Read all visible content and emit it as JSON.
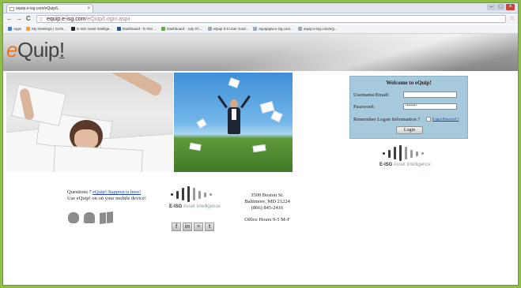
{
  "browser": {
    "tab_title": "equip.e-isg.com/eQuip/L",
    "tab_close": "×",
    "back": "←",
    "forward": "→",
    "reload": "C",
    "url_host": "equip.e-isg.com",
    "url_path": "/eQuip/Login.aspx",
    "bookmarks": [
      {
        "label": "Apps",
        "color": "#4a7bd0"
      },
      {
        "label": "My meetings | GoTo...",
        "color": "#f0a23a"
      },
      {
        "label": "E-ISG Asset Intellige...",
        "color": "#222222"
      },
      {
        "label": "Dashboard - E-ISG ...",
        "color": "#2b4f8c"
      },
      {
        "label": "Dashboard - July 07,...",
        "color": "#6aa84f"
      },
      {
        "label": "eQuip 6.5 User Guid...",
        "color": "#9aa7b5"
      },
      {
        "label": "equipqaw.e-isg.com...",
        "color": "#9aa7b5"
      },
      {
        "label": "equip.e-isg.com/eQ...",
        "color": "#9aa7b5"
      }
    ]
  },
  "site": {
    "logo_e": "e",
    "logo_rest": "Quip",
    "logo_bang": "!"
  },
  "login": {
    "title": "Welcome to eQuip!",
    "username_label": "Username/Email:",
    "username_value": "",
    "password_label": "Password:",
    "password_value": "••••••••",
    "remember_label": "Remember Logon Information ?",
    "forgot_label": "Forgot Password ?",
    "login_button": "Login"
  },
  "eisg_logo": {
    "brand": "E-ISG",
    "tagline": "Asset Intelligence"
  },
  "footer": {
    "questions_text": "Questions ?",
    "support_link": "eQuip! Support is here!",
    "mobile_text": "Use eQuip! on on your mobile device!",
    "address_line1": "3500 Boston St.",
    "address_line2": "Baltimore, MD 21224",
    "phone": "(866) 845-2416",
    "office_hours": "Office Hours 9-5 M-F",
    "social": [
      "f",
      "in",
      "≡",
      "t"
    ]
  },
  "colors": {
    "accent": "#e8731f",
    "login_bg": "#a6c9dc",
    "frame": "#8fbf4a"
  }
}
